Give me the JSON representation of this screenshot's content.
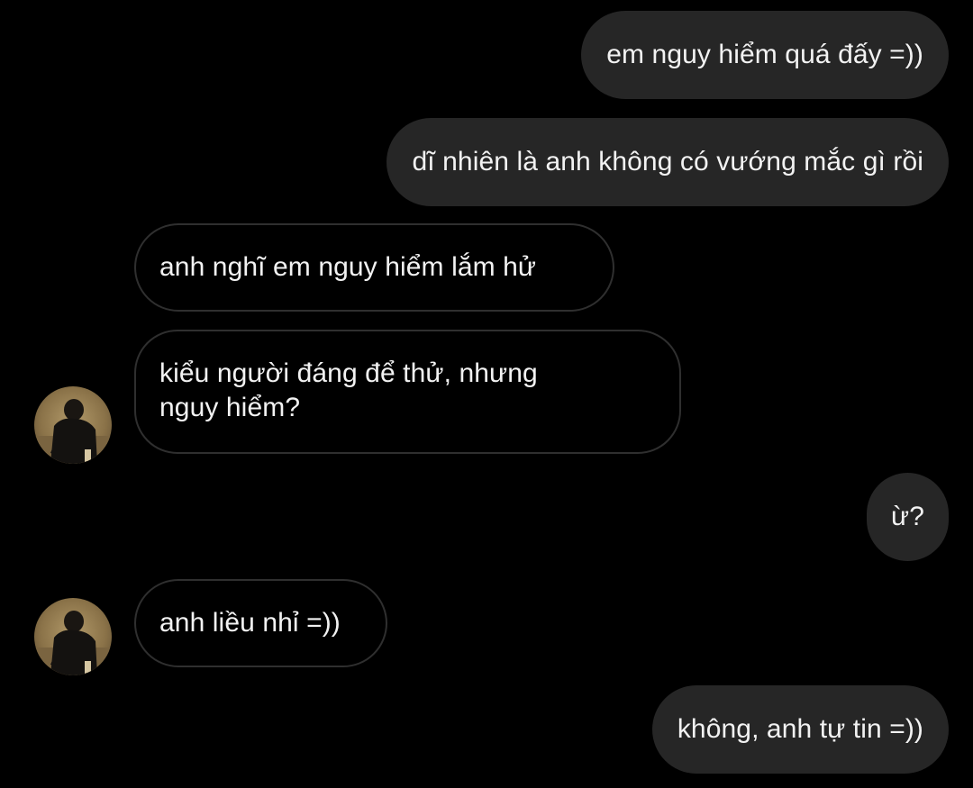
{
  "messages": [
    {
      "id": "m1",
      "direction": "sent",
      "text": "em nguy hiểm quá đấy =))"
    },
    {
      "id": "m2",
      "direction": "sent",
      "text": "dĩ nhiên là anh không có vướng mắc gì rồi"
    },
    {
      "id": "m3",
      "direction": "received",
      "text": "anh nghĩ em nguy hiểm lắm hử"
    },
    {
      "id": "m4",
      "direction": "received",
      "text": "kiểu người đáng để thử, nhưng nguy hiểm?"
    },
    {
      "id": "m5",
      "direction": "sent",
      "text": "ừ?"
    },
    {
      "id": "m6",
      "direction": "received",
      "text": "anh liều nhỉ =))"
    },
    {
      "id": "m7",
      "direction": "sent",
      "text": "không, anh tự tin =))"
    }
  ],
  "colors": {
    "background": "#000000",
    "sent_bubble": "#262626",
    "received_border": "#2f2f2f",
    "text": "#f2f2f2"
  },
  "icons": {
    "avatar": "profile-photo-avatar"
  }
}
